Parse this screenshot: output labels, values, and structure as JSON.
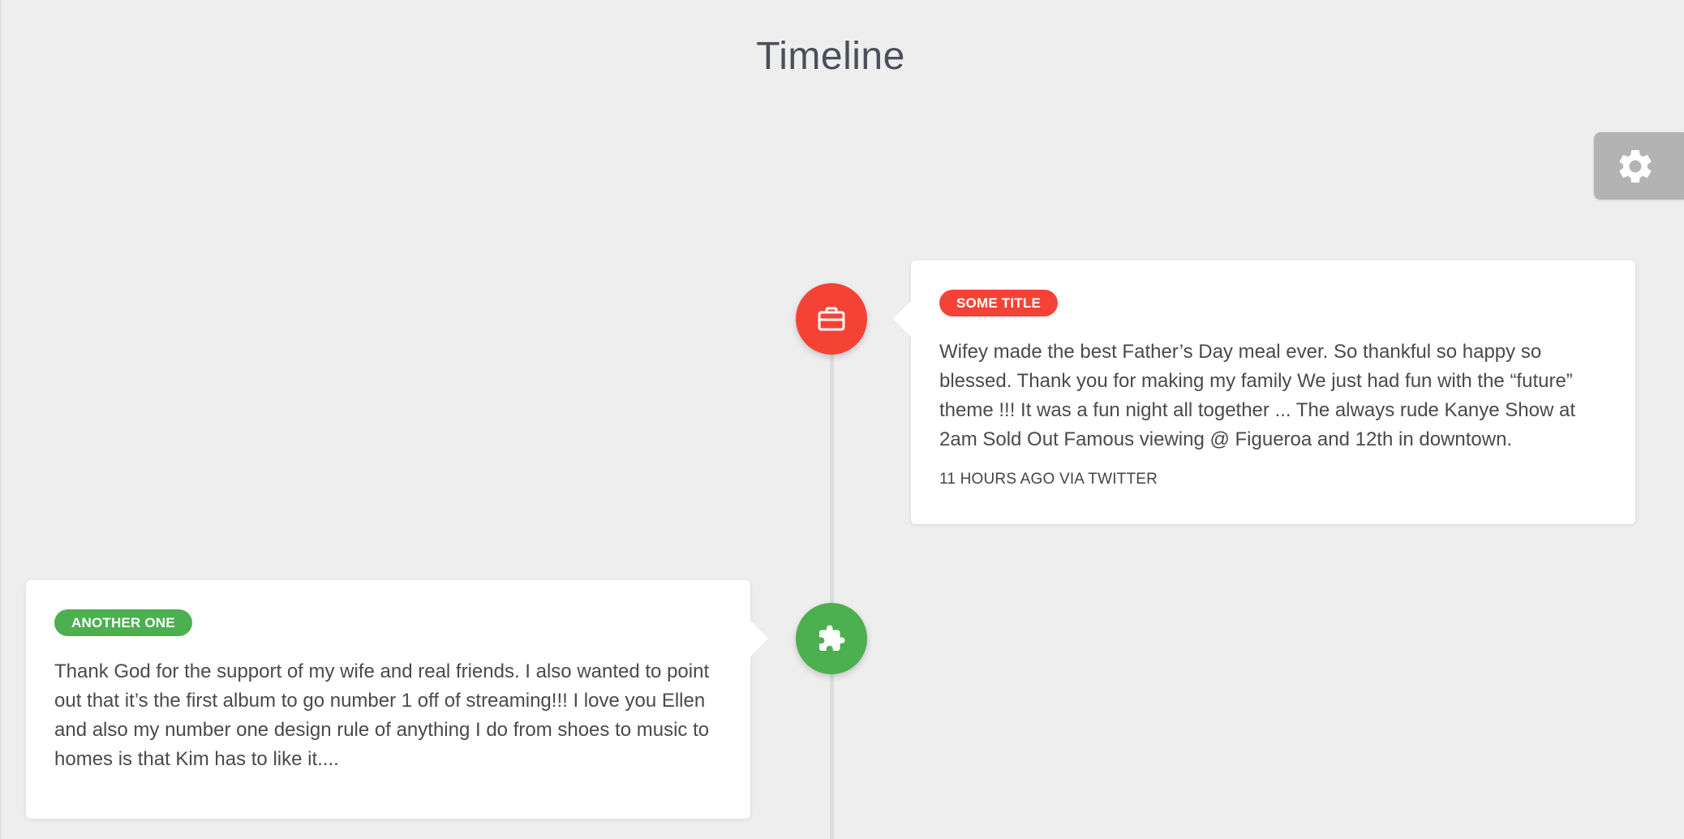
{
  "page": {
    "title": "Timeline"
  },
  "settings": {
    "icon": "gear-icon"
  },
  "colors": {
    "background": "#eeeeee",
    "red": "#f44336",
    "green": "#4caf50",
    "settings_bg": "#b3b3b3"
  },
  "timeline": {
    "items": [
      {
        "icon": "briefcase-icon",
        "label": "SOME TITLE",
        "body": "Wifey made the best Father’s Day meal ever. So thankful so happy so blessed. Thank you for making my family We just had fun with the “future” theme !!! It was a fun night all together ... The always rude Kanye Show at 2am Sold Out Famous viewing @ Figueroa and 12th in downtown.",
        "meta": "11 HOURS AGO VIA TWITTER",
        "color": "#f44336"
      },
      {
        "icon": "puzzle-icon",
        "label": "ANOTHER ONE",
        "body": "Thank God for the support of my wife and real friends. I also wanted to point out that it’s the first album to go number 1 off of streaming!!! I love you Ellen and also my number one design rule of anything I do from shoes to music to homes is that Kim has to like it....",
        "color": "#4caf50"
      }
    ]
  }
}
